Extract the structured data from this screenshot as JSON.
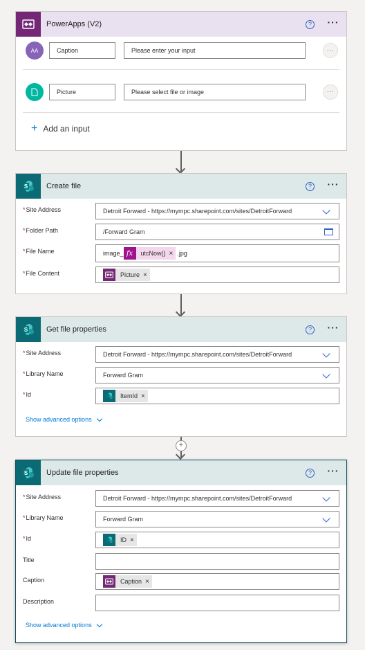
{
  "trigger": {
    "title": "PowerApps (V2)",
    "inputs": [
      {
        "name": "Caption",
        "placeholder": "Please enter your input",
        "avatar": "AA",
        "color": "#8764b8"
      },
      {
        "name": "Picture",
        "placeholder": "Please select file or image",
        "color": "#00b7a0"
      }
    ],
    "add_input_label": "Add an input"
  },
  "create_file": {
    "title": "Create file",
    "site_address_label": "Site Address",
    "site_address_value": "Detroit Forward - https://mympc.sharepoint.com/sites/DetroitForward",
    "folder_path_label": "Folder Path",
    "folder_path_value": "/Forward Gram",
    "file_name_label": "File Name",
    "file_name_prefix": "image_",
    "file_name_expr": "utcNow()",
    "file_name_suffix": ".jpg",
    "file_content_label": "File Content",
    "file_content_token": "Picture"
  },
  "get_props": {
    "title": "Get file properties",
    "site_address_label": "Site Address",
    "site_address_value": "Detroit Forward - https://mympc.sharepoint.com/sites/DetroitForward",
    "library_label": "Library Name",
    "library_value": "Forward Gram",
    "id_label": "Id",
    "id_token": "ItemId",
    "advanced_label": "Show advanced options"
  },
  "update_props": {
    "title": "Update file properties",
    "site_address_label": "Site Address",
    "site_address_value": "Detroit Forward - https://mympc.sharepoint.com/sites/DetroitForward",
    "library_label": "Library Name",
    "library_value": "Forward Gram",
    "id_label": "Id",
    "id_token": "ID",
    "title_label": "Title",
    "caption_label": "Caption",
    "caption_token": "Caption",
    "description_label": "Description",
    "advanced_label": "Show advanced options"
  },
  "common": {
    "help_glyph": "?",
    "more_glyph": "···",
    "remove_glyph": "×",
    "required_mark": "*",
    "expr_glyph": "fx",
    "plus_glyph": "+"
  }
}
